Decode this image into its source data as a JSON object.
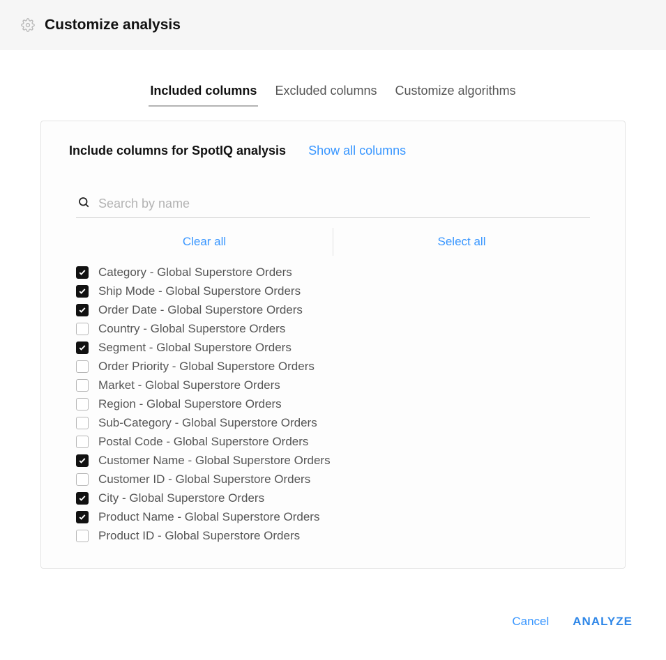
{
  "header": {
    "title": "Customize analysis"
  },
  "tabs": [
    {
      "label": "Included columns",
      "active": true
    },
    {
      "label": "Excluded columns",
      "active": false
    },
    {
      "label": "Customize algorithms",
      "active": false
    }
  ],
  "panel": {
    "title": "Include columns for SpotIQ analysis",
    "show_all": "Show all columns",
    "search_placeholder": "Search by name",
    "clear_all": "Clear all",
    "select_all": "Select all"
  },
  "columns": [
    {
      "label": "Category - Global Superstore Orders",
      "checked": true
    },
    {
      "label": "Ship Mode - Global Superstore Orders",
      "checked": true
    },
    {
      "label": "Order Date - Global Superstore Orders",
      "checked": true
    },
    {
      "label": "Country - Global Superstore Orders",
      "checked": false
    },
    {
      "label": "Segment - Global Superstore Orders",
      "checked": true
    },
    {
      "label": "Order Priority - Global Superstore Orders",
      "checked": false
    },
    {
      "label": "Market - Global Superstore Orders",
      "checked": false
    },
    {
      "label": "Region - Global Superstore Orders",
      "checked": false
    },
    {
      "label": "Sub-Category - Global Superstore Orders",
      "checked": false
    },
    {
      "label": "Postal Code - Global Superstore Orders",
      "checked": false
    },
    {
      "label": "Customer Name - Global Superstore Orders",
      "checked": true
    },
    {
      "label": "Customer ID - Global Superstore Orders",
      "checked": false
    },
    {
      "label": "City - Global Superstore Orders",
      "checked": true
    },
    {
      "label": "Product Name - Global Superstore Orders",
      "checked": true
    },
    {
      "label": "Product ID - Global Superstore Orders",
      "checked": false
    }
  ],
  "footer": {
    "cancel": "Cancel",
    "analyze": "ANALYZE"
  }
}
